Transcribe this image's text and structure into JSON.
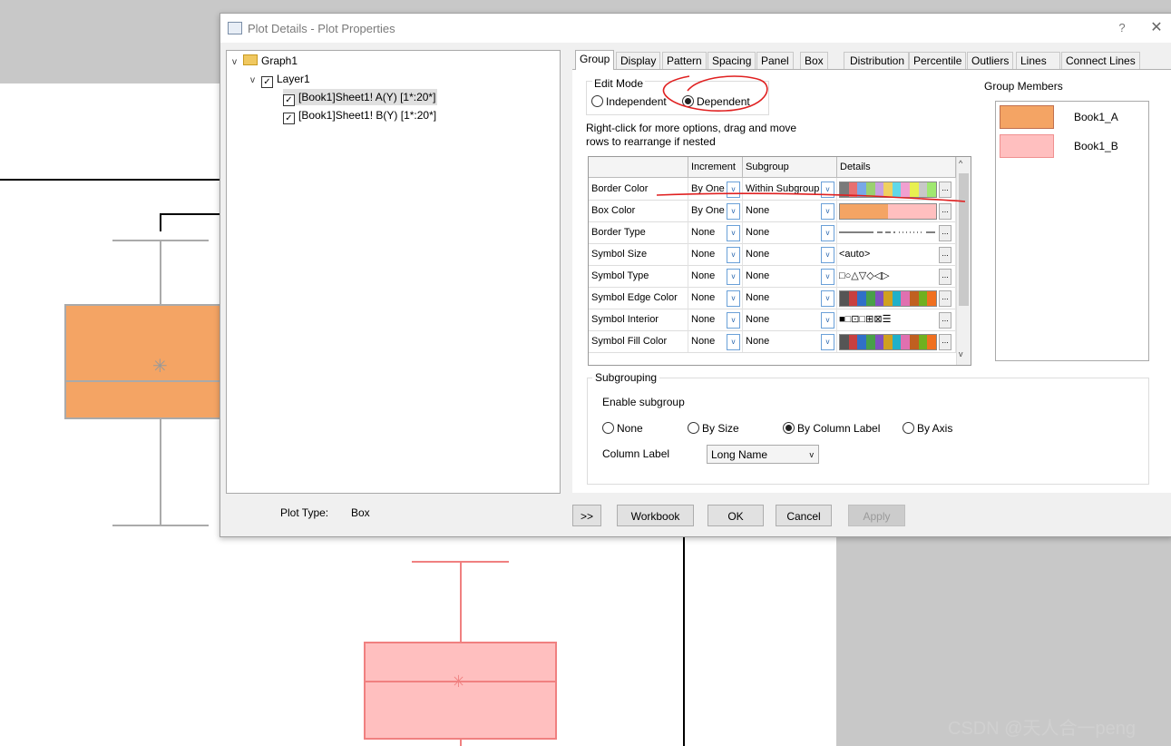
{
  "dialog": {
    "title": "Plot Details - Plot Properties",
    "help": "?",
    "close": "✕"
  },
  "tree": {
    "graph": "Graph1",
    "layer": "Layer1",
    "items": [
      "[Book1]Sheet1! A(Y) [1*:20*]",
      "[Book1]Sheet1! B(Y) [1*:20*]"
    ]
  },
  "plot_type": {
    "label": "Plot Type:",
    "value": "Box"
  },
  "tabs": [
    "Group",
    "Display",
    "Pattern",
    "Spacing",
    "Panel",
    "Box",
    "Distribution",
    "Percentile",
    "Outliers",
    "Lines",
    "Connect Lines"
  ],
  "edit_mode": {
    "label": "Edit Mode",
    "independent": "Independent",
    "dependent": "Dependent",
    "selected": "Dependent"
  },
  "hint": {
    "line1": "Right-click for more options, drag and move",
    "line2": "rows to  rearrange if nested"
  },
  "grid": {
    "headers": [
      "",
      "Increment",
      "Subgroup",
      "Details"
    ],
    "rows": [
      {
        "name": "Border Color",
        "increment": "By One",
        "subgroup": "Within Subgroup",
        "details": "colors"
      },
      {
        "name": "Box Color",
        "increment": "By One",
        "subgroup": "None",
        "details": "colors2"
      },
      {
        "name": "Border Type",
        "increment": "None",
        "subgroup": "None",
        "details": "lines"
      },
      {
        "name": "Symbol Size",
        "increment": "None",
        "subgroup": "None",
        "details": "<auto>"
      },
      {
        "name": "Symbol Type",
        "increment": "None",
        "subgroup": "None",
        "details": "□○△▽◇◁▷"
      },
      {
        "name": "Symbol Edge Color",
        "increment": "None",
        "subgroup": "None",
        "details": "colors"
      },
      {
        "name": "Symbol Interior",
        "increment": "None",
        "subgroup": "None",
        "details": "■□⊡□⊞⊠☰"
      },
      {
        "name": "Symbol Fill Color",
        "increment": "None",
        "subgroup": "None",
        "details": "colors"
      }
    ]
  },
  "group_members": {
    "label": "Group Members",
    "items": [
      {
        "name": "Book1_A",
        "color": "#F4A464"
      },
      {
        "name": "Book1_B",
        "color": "#FFBFBF"
      }
    ]
  },
  "subgrouping": {
    "label": "Subgrouping",
    "enable_label": "Enable subgroup",
    "options": [
      "None",
      "By Size",
      "By Column Label",
      "By Axis"
    ],
    "selected": "By Column Label",
    "column_label": "Column Label",
    "column_value": "Long Name"
  },
  "buttons": {
    "expand": ">>",
    "workbook": "Workbook",
    "ok": "OK",
    "cancel": "Cancel",
    "apply": "Apply"
  },
  "watermark": "CSDN @天人合一peng",
  "colors": {
    "box_a": "#F4A464",
    "box_b": "#FFBFBF",
    "annotation_red": "#E02020"
  }
}
